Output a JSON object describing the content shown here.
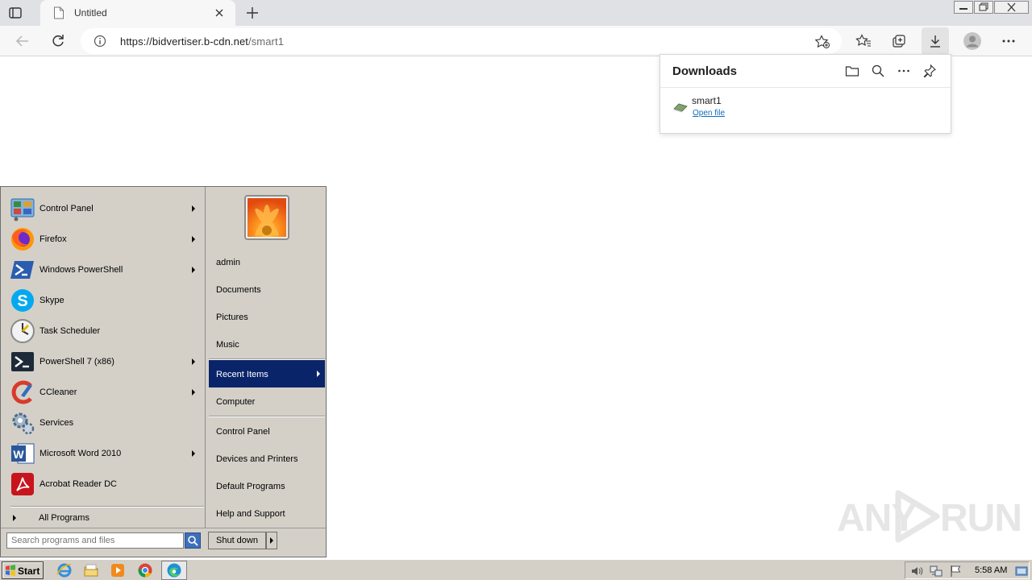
{
  "browser": {
    "tab": {
      "title": "Untitled"
    },
    "address": {
      "host": "https://bidvertiser.b-cdn.net",
      "path": "/smart1"
    }
  },
  "downloads": {
    "title": "Downloads",
    "items": [
      {
        "filename": "smart1",
        "action": "Open file"
      }
    ]
  },
  "start_menu": {
    "programs": [
      {
        "label": "Control Panel",
        "icon": "control-panel-icon",
        "submenu": true
      },
      {
        "label": "Firefox",
        "icon": "firefox-icon",
        "submenu": true
      },
      {
        "label": "Windows PowerShell",
        "icon": "powershell-icon",
        "submenu": true
      },
      {
        "label": "Skype",
        "icon": "skype-icon",
        "submenu": false
      },
      {
        "label": "Task Scheduler",
        "icon": "task-scheduler-icon",
        "submenu": false
      },
      {
        "label": "PowerShell 7 (x86)",
        "icon": "powershell7-icon",
        "submenu": true
      },
      {
        "label": "CCleaner",
        "icon": "ccleaner-icon",
        "submenu": true
      },
      {
        "label": "Services",
        "icon": "services-icon",
        "submenu": false
      },
      {
        "label": "Microsoft Word 2010",
        "icon": "word-icon",
        "submenu": true
      },
      {
        "label": "Acrobat Reader DC",
        "icon": "acrobat-icon",
        "submenu": false
      }
    ],
    "all_programs": "All Programs",
    "search_placeholder": "Search programs and files",
    "right_items": [
      {
        "label": "admin"
      },
      {
        "label": "Documents"
      },
      {
        "label": "Pictures"
      },
      {
        "label": "Music"
      },
      {
        "label": "Recent Items",
        "selected": true
      },
      {
        "label": "Computer"
      },
      {
        "label": "Control Panel"
      },
      {
        "label": "Devices and Printers"
      },
      {
        "label": "Default Programs"
      },
      {
        "label": "Help and Support"
      }
    ],
    "shutdown": "Shut down"
  },
  "taskbar": {
    "start": "Start",
    "clock": "5:58 AM",
    "pinned_icons": [
      "ie-icon",
      "explorer-icon",
      "media-player-icon",
      "chrome-icon",
      "edge-icon"
    ]
  },
  "watermark": {
    "left": "ANY",
    "right": "RUN"
  },
  "colors": {
    "selection": "#0a246a",
    "link": "#0f6cbd",
    "classic_gray": "#d4d0c8"
  }
}
